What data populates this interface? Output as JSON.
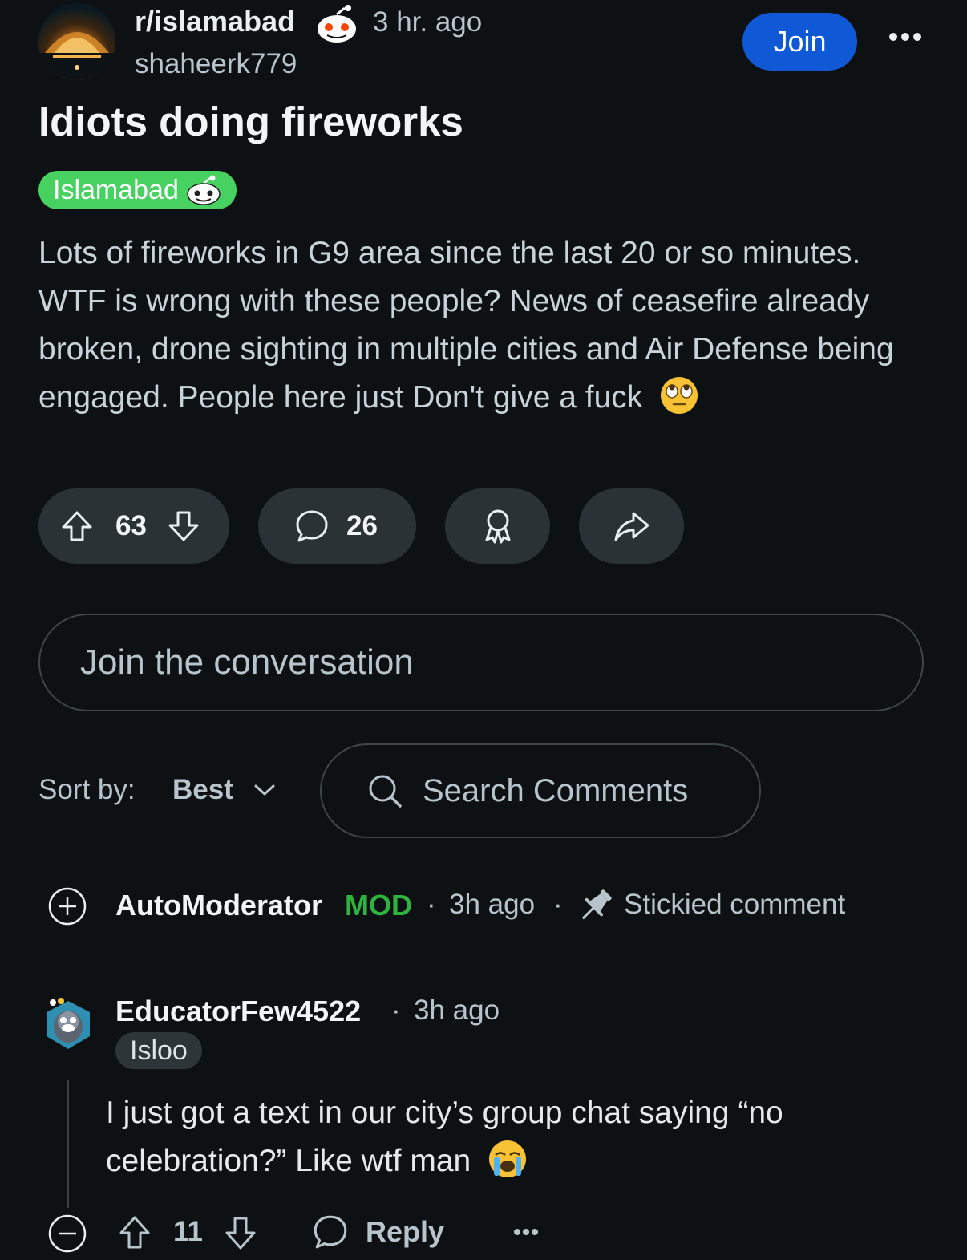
{
  "post": {
    "subreddit": "r/islamabad",
    "time_ago": "3 hr. ago",
    "author": "shaheerk779",
    "join_label": "Join",
    "title": "Idiots doing fireworks",
    "flair": "Islamabad",
    "body": "Lots of fireworks in G9 area since the last 20 or so minutes. WTF is wrong with these people? News of ceasefire already broken, drone sighting in multiple cities and Air Defense being engaged. People here just Don't give a fuck",
    "upvotes": "63",
    "comments": "26"
  },
  "composer": {
    "placeholder": "Join the conversation"
  },
  "sort": {
    "label": "Sort by:",
    "value": "Best"
  },
  "search": {
    "placeholder": "Search Comments"
  },
  "comments": [
    {
      "author": "AutoModerator",
      "badge": "MOD",
      "time": "3h ago",
      "sticky_label": "Stickied comment"
    },
    {
      "author": "EducatorFew4522",
      "time": "3h ago",
      "flair": "Isloo",
      "text": "I just got a text in our city’s group chat saying “no celebration?” Like wtf man",
      "votes": "11",
      "reply_label": "Reply"
    }
  ],
  "colors": {
    "background": "#0e1113",
    "join_blue": "#0f58d6",
    "flair_green": "#46d160",
    "mod_green": "#2fb33f",
    "pill_bg": "#2a3236"
  },
  "icons": [
    "snoo-icon",
    "more-icon",
    "upvote-icon",
    "downvote-icon",
    "comment-icon",
    "award-icon",
    "share-icon",
    "chevron-down-icon",
    "search-icon",
    "expand-icon",
    "pin-icon",
    "collapse-icon",
    "eye-roll-emoji",
    "crying-emoji"
  ]
}
